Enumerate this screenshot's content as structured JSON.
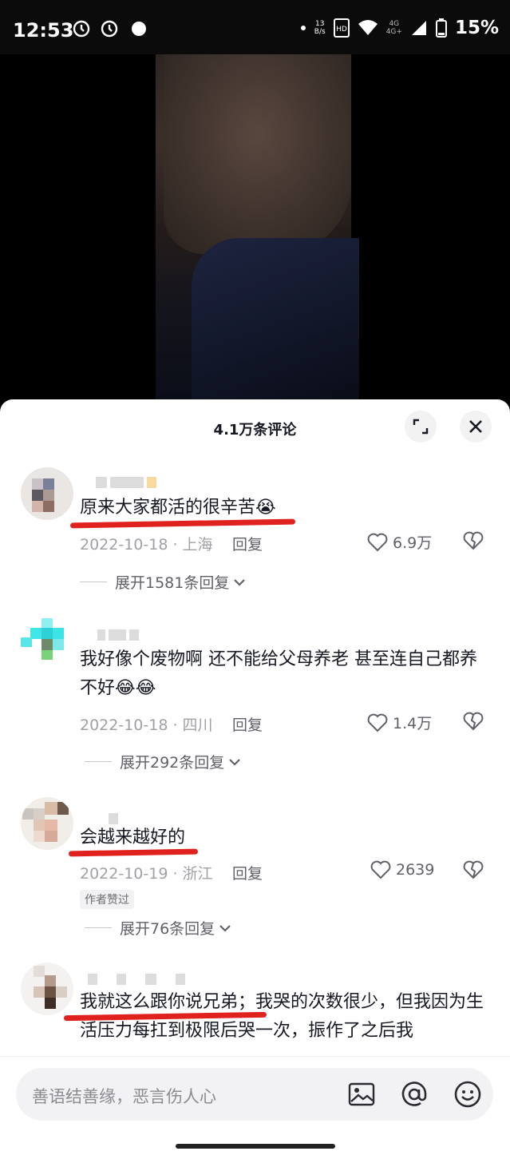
{
  "status_bar": {
    "time": "12:53",
    "net_speed_top": "13",
    "net_speed_bottom": "B/s",
    "net_4g_top": "4G",
    "net_4g_bottom": "4G+",
    "battery": "15%"
  },
  "sheet": {
    "title": "4.1万条评论"
  },
  "comments": [
    {
      "text": "原来大家都活的很辛苦😭",
      "date_location": "2022-10-18 · 上海",
      "reply_label": "回复",
      "likes": "6.9万",
      "expand_label": "展开1581条回复"
    },
    {
      "text": "我好像个废物啊 还不能给父母养老 甚至连自己都养不好😂😂",
      "date_location": "2022-10-18 · 四川",
      "reply_label": "回复",
      "likes": "1.4万",
      "expand_label": "展开292条回复"
    },
    {
      "text": "会越来越好的",
      "date_location": "2022-10-19 · 浙江",
      "reply_label": "回复",
      "likes": "2639",
      "badge": "作者赞过",
      "expand_label": "展开76条回复"
    },
    {
      "text": "我就这么跟你说兄弟；我哭的次数很少，但我因为生活压力每扛到极限后哭一次，振作了之后我"
    }
  ],
  "input": {
    "placeholder": "善语结善缘，恶言伤人心"
  },
  "colors": {
    "accent_red": "#e0221f",
    "text_primary": "#161823",
    "text_secondary": "#a0a0a6"
  }
}
